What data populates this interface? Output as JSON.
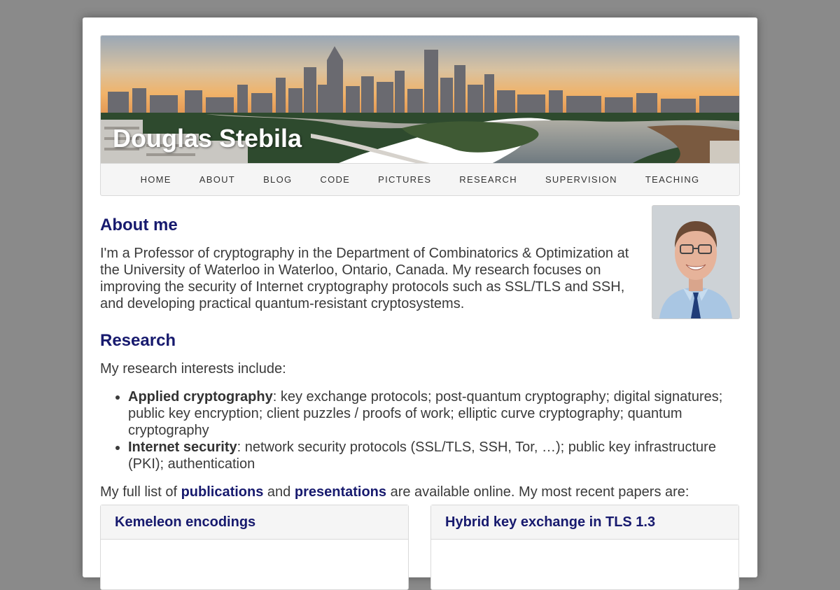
{
  "site": {
    "title": "Douglas Stebila"
  },
  "nav": {
    "items": [
      "HOME",
      "ABOUT",
      "BLOG",
      "CODE",
      "PICTURES",
      "RESEARCH",
      "SUPERVISION",
      "TEACHING"
    ]
  },
  "about": {
    "heading": "About me",
    "text": "I'm a Professor of cryptography in the Department of Combinatorics & Optimization at the University of Waterloo in Waterloo, Ontario, Canada. My research focuses on improving the security of Internet cryptography protocols such as SSL/TLS and SSH, and developing practical quantum-resistant cryptosystems."
  },
  "research": {
    "heading": "Research",
    "intro": "My research interests include:",
    "interests": [
      {
        "title": "Applied cryptography",
        "text": ": key exchange protocols; post-quantum cryptography; digital signatures; public key encryption; client puzzles / proofs of work; elliptic curve cryptography; quantum cryptography"
      },
      {
        "title": "Internet security",
        "text": ": network security protocols (SSL/TLS, SSH, Tor, …); public key infrastructure (PKI); authentication"
      }
    ],
    "pubs_prefix": "My full list of ",
    "pubs_link": "publications",
    "pubs_and": " and ",
    "pres_link": "presentations",
    "pubs_suffix": " are available online. My most recent papers are:"
  },
  "papers": [
    {
      "title": "Kemeleon encodings"
    },
    {
      "title": "Hybrid key exchange in TLS 1.3"
    }
  ],
  "colors": {
    "heading": "#171a6e",
    "background": "#8a8a8a",
    "card": "#ffffff"
  }
}
